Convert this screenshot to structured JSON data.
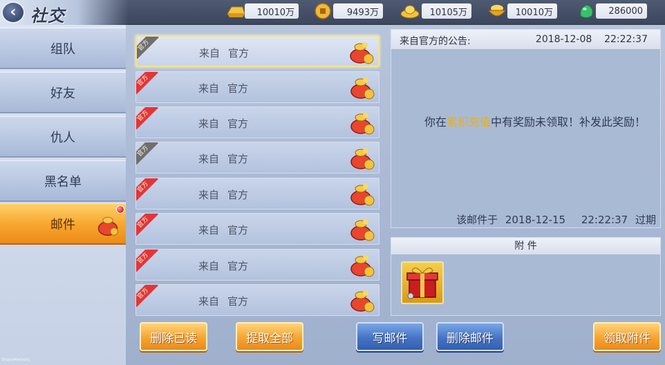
{
  "header": {
    "title": "社交",
    "currencies": [
      {
        "icon": "gold-ingot-icon",
        "value": "10010万"
      },
      {
        "icon": "copper-coin-icon",
        "value": "9493万"
      },
      {
        "icon": "yuanbao-icon",
        "value": "10105万"
      },
      {
        "icon": "treasure-bowl-icon",
        "value": "10010万"
      },
      {
        "icon": "jade-icon",
        "value": "286000"
      }
    ]
  },
  "nav": {
    "items": [
      {
        "label": "组队"
      },
      {
        "label": "好友"
      },
      {
        "label": "仇人"
      },
      {
        "label": "黑名单"
      },
      {
        "label": "邮件",
        "active": true,
        "badge": true
      }
    ]
  },
  "mail_list": {
    "items": [
      {
        "tag": "官方",
        "from_label": "来自",
        "sender": "官方",
        "selected": true,
        "read": true
      },
      {
        "tag": "官方",
        "from_label": "来自",
        "sender": "官方"
      },
      {
        "tag": "官方",
        "from_label": "来自",
        "sender": "官方"
      },
      {
        "tag": "官方",
        "from_label": "来自",
        "sender": "官方",
        "read": true
      },
      {
        "tag": "官方",
        "from_label": "来自",
        "sender": "官方"
      },
      {
        "tag": "官方",
        "from_label": "来自",
        "sender": "官方"
      },
      {
        "tag": "官方",
        "from_label": "来自",
        "sender": "官方"
      },
      {
        "tag": "官方",
        "from_label": "来自",
        "sender": "官方"
      }
    ]
  },
  "notice": {
    "title": "来自官方的公告:",
    "date": "2018-12-08",
    "time": "22:22:37",
    "body_prefix": "你在",
    "body_highlight": "累积充值",
    "body_suffix": "中有奖励未领取！补发此奖励！",
    "expire_prefix": "该邮件于",
    "expire_date": "2018-12-15",
    "expire_time": "22:22:37",
    "expire_suffix": "过期"
  },
  "attachment": {
    "title": "附 件",
    "items": [
      {
        "icon": "red-gift-box-icon"
      }
    ]
  },
  "buttons": {
    "delete_read": "删除已读",
    "collect_all": "提取全部",
    "write_mail": "写邮件",
    "delete_mail": "删除邮件",
    "claim_attachment": "领取附件"
  },
  "watermark": "ShareMemory",
  "colors": {
    "accent_orange": "#f6a431",
    "accent_blue": "#4574c4",
    "highlight_gold": "#e9b01a",
    "ribbon_red": "#e2353a"
  }
}
